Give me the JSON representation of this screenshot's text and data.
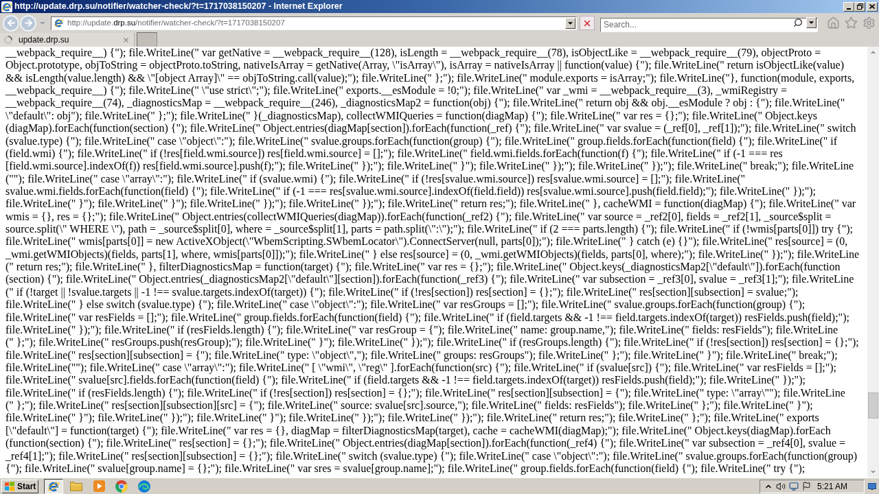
{
  "window": {
    "title": "http://update.drp.su/notifier/watcher-check/?t=1717038150207 - Internet Explorer"
  },
  "toolbar": {
    "address": {
      "prefix": "http://update.",
      "domain": "drp.su",
      "path": "/notifier/watcher-check/?t=1717038150207"
    },
    "search": {
      "placeholder": "Search..."
    }
  },
  "tabs": [
    {
      "label": "update.drp.su",
      "selected": true
    }
  ],
  "page": {
    "lines": [
      "__webpack_require__) {\"); file.WriteLine(\" var getNative = __webpack_require__(128), isLength = __webpack_require__(78), isObjectLike = __webpack_require__(79), objectProto =",
      "Object.prototype, objToString = objectProto.toString, nativeIsArray = getNative(Array, \\\"isArray\\\"), isArray = nativeIsArray || function(value) {\"); file.WriteLine(\" return isObjectLike(value)",
      "&& isLength(value.length) && \\\"[object Array]\\\" == objToString.call(value);\"); file.WriteLine(\" };\"); file.WriteLine(\" module.exports = isArray;\"); file.WriteLine(\"}, function(module, exports,",
      "__webpack_require__) {\"); file.WriteLine(\" \\\"use strict\\\";\"); file.WriteLine(\" exports.__esModule = !0;\"); file.WriteLine(\" var _wmi = __webpack_require__(3), _wmiRegistry =",
      "__webpack_require__(74), _diagnosticsMap = __webpack_require__(246), _diagnosticsMap2 = function(obj) {\"); file.WriteLine(\" return obj && obj.__esModule ? obj : {\"); file.WriteLine(\"",
      "\\\"default\\\": obj\"); file.WriteLine(\" };\"); file.WriteLine(\" }(_diagnosticsMap), collectWMIQueries = function(diagMap) {\"); file.WriteLine(\" var res = {};\"); file.WriteLine(\" Object.keys",
      "(diagMap).forEach(function(section) {\"); file.WriteLine(\" Object.entries(diagMap[section]).forEach(function(_ref) {\"); file.WriteLine(\" var svalue = (_ref[0], _ref[1]);\"); file.WriteLine(\" switch",
      "(svalue.type) {\"); file.WriteLine(\" case \\\"object\\\":\"); file.WriteLine(\" svalue.groups.forEach(function(group) {\"); file.WriteLine(\" group.fields.forEach(function(field) {\"); file.WriteLine(\" if",
      "(field.wmi) {\"); file.WriteLine(\" if (!res[field.wmi.source]) res[field.wmi.source] = [];\"); file.WriteLine(\" field.wmi.fields.forEach(function(f) {\"); file.WriteLine(\" if (-1 === res",
      "[field.wmi.source].indexOf(f)) res[field.wmi.source].push(f);\"); file.WriteLine(\" });\"); file.WriteLine(\" }\"); file.WriteLine(\" });\"); file.WriteLine(\" });\"); file.WriteLine(\" break;\"); file.WriteLine",
      "(\"\"); file.WriteLine(\" case \\\"array\\\":\"); file.WriteLine(\" if (svalue.wmi) {\"); file.WriteLine(\" if (!res[svalue.wmi.source]) res[svalue.wmi.source] = [];\"); file.WriteLine(\"",
      "svalue.wmi.fields.forEach(function(field) {\"); file.WriteLine(\" if (-1 === res[svalue.wmi.source].indexOf(field.field)) res[svalue.wmi.source].push(field.field);\"); file.WriteLine(\" });\");",
      "file.WriteLine(\" }\"); file.WriteLine(\" }\"); file.WriteLine(\" });\"); file.WriteLine(\" });\"); file.WriteLine(\" return res;\"); file.WriteLine(\" }, cacheWMI = function(diagMap) {\"); file.WriteLine(\" var",
      "wmis = {}, res = {};\"); file.WriteLine(\" Object.entries(collectWMIQueries(diagMap)).forEach(function(_ref2) {\"); file.WriteLine(\" var source = _ref2[0], fields = _ref2[1], _source$split =",
      "source.split(\\\" WHERE \\\"), path = _source$split[0], where = _source$split[1], parts = path.split(\\\":\\\");\"); file.WriteLine(\" if (2 === parts.length) {\"); file.WriteLine(\" if (!wmis[parts[0]]) try {\");",
      "file.WriteLine(\" wmis[parts[0]] = new ActiveXObject(\\\"WbemScripting.SWbemLocator\\\").ConnectServer(null, parts[0]);\"); file.WriteLine(\" } catch (e) {}\"); file.WriteLine(\" res[source] = (0,",
      "_wmi.getWMIObjects)(fields, parts[1], where, wmis[parts[0]]);\"); file.WriteLine(\" } else res[source] = (0, _wmi.getWMIObjects)(fields, parts[0], where);\"); file.WriteLine(\" });\"); file.WriteLine",
      "(\" return res;\"); file.WriteLine(\" }, filterDiagnosticsMap = function(target) {\"); file.WriteLine(\" var res = {};\"); file.WriteLine(\" Object.keys(_diagnosticsMap2[\\\"default\\\"]).forEach(function",
      "(section) {\"); file.WriteLine(\" Object.entries(_diagnosticsMap2[\\\"default\\\"][section]).forEach(function(_ref3) {\"); file.WriteLine(\" var subsection = _ref3[0], svalue = _ref3[1];\"); file.WriteLine",
      "(\" if (!target || !svalue.targets || -1 !== svalue.targets.indexOf(target)) {\"); file.WriteLine(\" if (!res[section]) res[section] = {};\"); file.WriteLine(\" res[section][subsection] = svalue;\");",
      "file.WriteLine(\" } else switch (svalue.type) {\"); file.WriteLine(\" case \\\"object\\\":\"); file.WriteLine(\" var resGroups = [];\"); file.WriteLine(\" svalue.groups.forEach(function(group) {\");",
      "file.WriteLine(\" var resFields = [];\"); file.WriteLine(\" group.fields.forEach(function(field) {\"); file.WriteLine(\" if (field.targets && -1 !== field.targets.indexOf(target)) resFields.push(field);\");",
      "file.WriteLine(\" });\"); file.WriteLine(\" if (resFields.length) {\"); file.WriteLine(\" var resGroup = {\"); file.WriteLine(\" name: group.name,\"); file.WriteLine(\" fields: resFields\"); file.WriteLine",
      "(\" };\"); file.WriteLine(\" resGroups.push(resGroup);\"); file.WriteLine(\" }\"); file.WriteLine(\" });\"); file.WriteLine(\" if (resGroups.length) {\"); file.WriteLine(\" if (!res[section]) res[section] = {};\");",
      "file.WriteLine(\" res[section][subsection] = {\"); file.WriteLine(\" type: \\\"object\\\",\"); file.WriteLine(\" groups: resGroups\"); file.WriteLine(\" };\"); file.WriteLine(\" }\"); file.WriteLine(\" break;\");",
      "file.WriteLine(\"\"); file.WriteLine(\" case \\\"array\\\":\"); file.WriteLine(\" [ \\\"wmi\\\", \\\"reg\\\" ].forEach(function(src) {\"); file.WriteLine(\" if (svalue[src]) {\"); file.WriteLine(\" var resFields = [];\");",
      "file.WriteLine(\" svalue[src].fields.forEach(function(field) {\"); file.WriteLine(\" if (field.targets && -1 !== field.targets.indexOf(target)) resFields.push(field);\"); file.WriteLine(\" });\");",
      "file.WriteLine(\" if (resFields.length) {\"); file.WriteLine(\" if (!res[section]) res[section] = {};\"); file.WriteLine(\" res[section][subsection] = {\"); file.WriteLine(\" type: \\\"array\\\"\"); file.WriteLine",
      "(\" };\"); file.WriteLine(\" res[section][subsection][src] = {\"); file.WriteLine(\" source: svalue[src].source,\"); file.WriteLine(\" fields: resFields\"); file.WriteLine(\" };\"); file.WriteLine(\" }\");",
      "file.WriteLine(\" }\"); file.WriteLine(\" });\"); file.WriteLine(\" }\"); file.WriteLine(\" });\"); file.WriteLine(\" });\"); file.WriteLine(\" return res;\"); file.WriteLine(\" };\"); file.WriteLine(\" exports",
      "[\\\"default\\\"] = function(target) {\"); file.WriteLine(\" var res = {}, diagMap = filterDiagnosticsMap(target), cache = cacheWMI(diagMap);\"); file.WriteLine(\" Object.keys(diagMap).forEach",
      "(function(section) {\"); file.WriteLine(\" res[section] = {};\"); file.WriteLine(\" Object.entries(diagMap[section]).forEach(function(_ref4) {\"); file.WriteLine(\" var subsection = _ref4[0], svalue =",
      "_ref4[1];\"); file.WriteLine(\" res[section][subsection] = {};\"); file.WriteLine(\" switch (svalue.type) {\"); file.WriteLine(\" case \\\"object\\\":\"); file.WriteLine(\" svalue.groups.forEach(function(group)",
      "{\"); file.WriteLine(\" svalue[group.name] = {};\"); file.WriteLine(\" var sres = svalue[group.name];\"); file.WriteLine(\" group.fields.forEach(function(field) {\"); file.WriteLine(\" try {\");"
    ]
  },
  "taskbar": {
    "start": "Start",
    "apps": [
      {
        "kind": "browser",
        "selected": true
      },
      {
        "kind": "folder",
        "selected": false
      },
      {
        "kind": "player",
        "selected": false
      },
      {
        "kind": "round-browser",
        "selected": false
      },
      {
        "kind": "swirl-browser",
        "selected": false
      }
    ],
    "clock": "5:21 AM"
  }
}
